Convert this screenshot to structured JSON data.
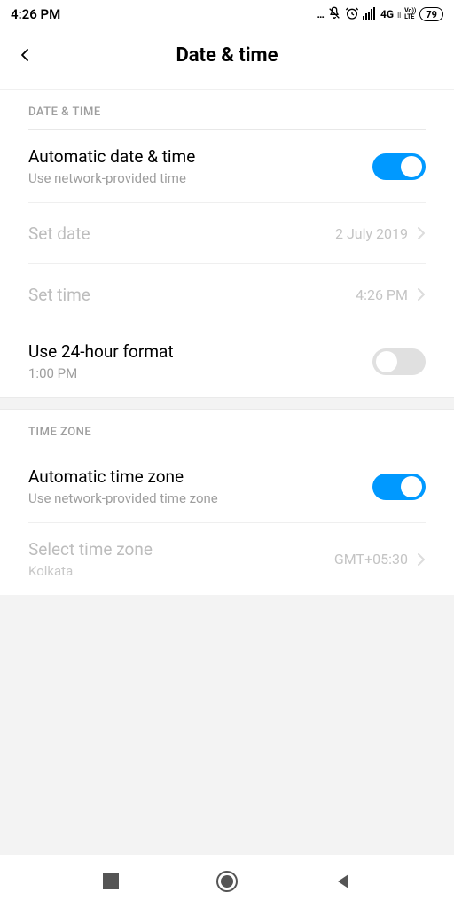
{
  "status": {
    "time": "4:26 PM",
    "dots": "...",
    "network": "4G",
    "volte": "Vo))\nLTE",
    "battery": "79"
  },
  "header": {
    "title": "Date & time"
  },
  "sections": {
    "datetime": {
      "header": "DATE & TIME",
      "auto": {
        "title": "Automatic date & time",
        "sub": "Use network-provided time"
      },
      "setdate": {
        "title": "Set date",
        "value": "2 July 2019"
      },
      "settime": {
        "title": "Set time",
        "value": "4:26 PM"
      },
      "format24": {
        "title": "Use 24-hour format",
        "sub": "1:00 PM"
      }
    },
    "timezone": {
      "header": "TIME ZONE",
      "auto": {
        "title": "Automatic time zone",
        "sub": "Use network-provided time zone"
      },
      "select": {
        "title": "Select time zone",
        "sub": "Kolkata",
        "value": "GMT+05:30"
      }
    }
  }
}
